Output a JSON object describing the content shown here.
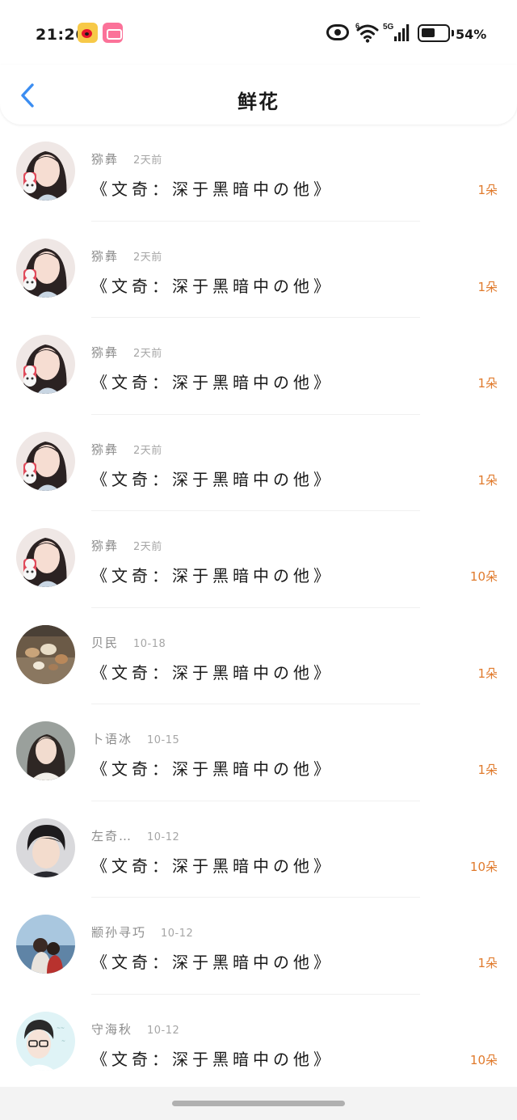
{
  "status_bar": {
    "time": "21:26",
    "battery_text": "54%",
    "battery_level": 0.54,
    "network_label": "5G",
    "wifi_badge": "6",
    "apps": [
      "weibo-icon",
      "bilibili-icon"
    ]
  },
  "header": {
    "title": "鲜花",
    "back_icon": "chevron-left-icon",
    "accent_color": "#3b8df1"
  },
  "colors": {
    "count_color": "#e07a2c",
    "name_color": "#8c8c8c"
  },
  "list": [
    {
      "name": "猕彝",
      "time": "2天前",
      "book": "《文奇：深于黑暗中の他》",
      "count": "1朵",
      "avatar": "avatar-girl-icon"
    },
    {
      "name": "猕彝",
      "time": "2天前",
      "book": "《文奇：深于黑暗中の他》",
      "count": "1朵",
      "avatar": "avatar-girl-icon"
    },
    {
      "name": "猕彝",
      "time": "2天前",
      "book": "《文奇：深于黑暗中の他》",
      "count": "1朵",
      "avatar": "avatar-girl-icon"
    },
    {
      "name": "猕彝",
      "time": "2天前",
      "book": "《文奇：深于黑暗中の他》",
      "count": "1朵",
      "avatar": "avatar-girl-icon"
    },
    {
      "name": "猕彝",
      "time": "2天前",
      "book": "《文奇：深于黑暗中の他》",
      "count": "10朵",
      "avatar": "avatar-girl-icon"
    },
    {
      "name": "贝民",
      "time": "10-18",
      "book": "《文奇：深于黑暗中の他》",
      "count": "1朵",
      "avatar": "avatar-shells-icon"
    },
    {
      "name": "卜语冰",
      "time": "10-15",
      "book": "《文奇：深于黑暗中の他》",
      "count": "1朵",
      "avatar": "avatar-woman-icon"
    },
    {
      "name": "左奇…",
      "time": "10-12",
      "book": "《文奇：深于黑暗中の他》",
      "count": "10朵",
      "avatar": "avatar-boy-icon"
    },
    {
      "name": "颛孙寻巧",
      "time": "10-12",
      "book": "《文奇：深于黑暗中の他》",
      "count": "1朵",
      "avatar": "avatar-couple-icon"
    },
    {
      "name": "守海秋",
      "time": "10-12",
      "book": "《文奇：深于黑暗中の他》",
      "count": "10朵",
      "avatar": "avatar-glasses-icon"
    }
  ]
}
